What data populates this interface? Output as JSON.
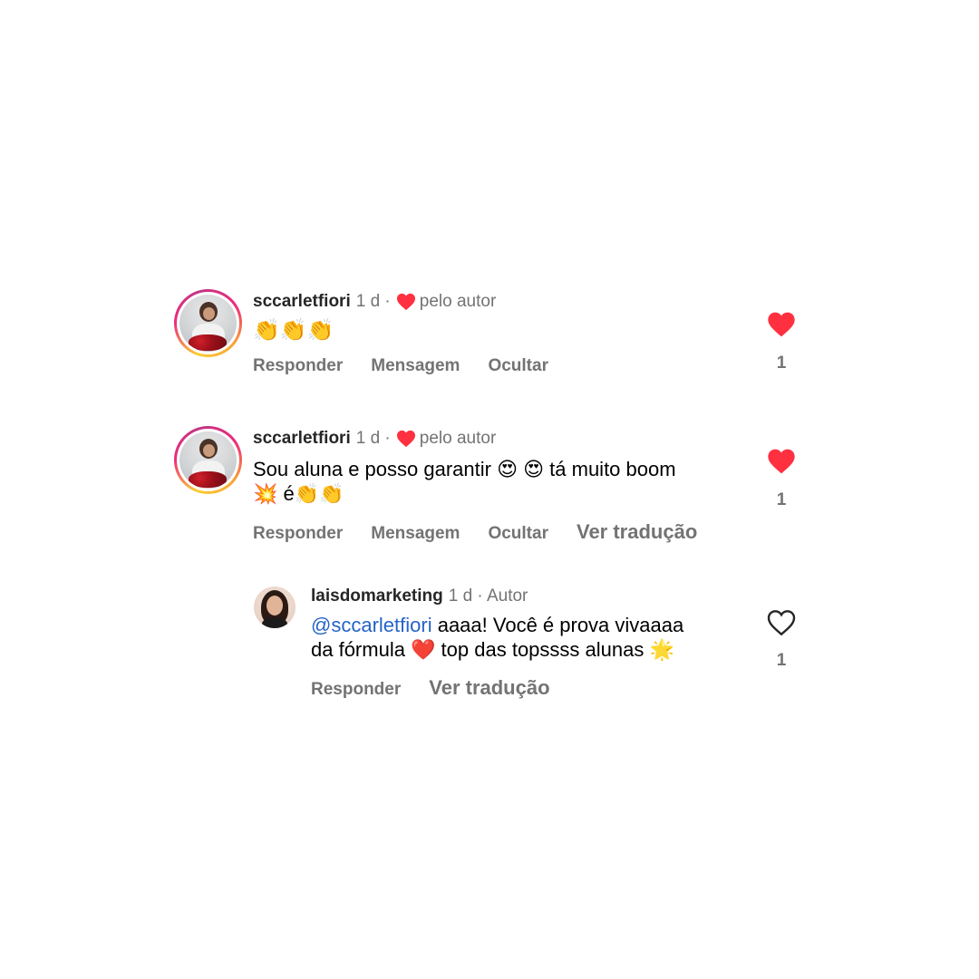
{
  "comments": [
    {
      "username": "sccarletfiori",
      "time": "1 d ·",
      "liked_by_author_label": "pelo autor",
      "text_emoji": "👏👏👏",
      "actions": {
        "reply": "Responder",
        "message": "Mensagem",
        "hide": "Ocultar"
      },
      "like_count": "1",
      "liked": true
    },
    {
      "username": "sccarletfiori",
      "time": "1 d ·",
      "liked_by_author_label": "pelo autor",
      "text_line1": "Sou aluna e posso garantir 😍 😍 tá muito boom",
      "text_line2": "💥 é👏👏",
      "actions": {
        "reply": "Responder",
        "message": "Mensagem",
        "hide": "Ocultar",
        "translate": "Ver tradução"
      },
      "like_count": "1",
      "liked": true
    }
  ],
  "reply": {
    "username": "laisdomarketing",
    "time": "1 d · Autor",
    "mention": "@sccarletfiori",
    "text_line1_rest": " aaaa! Você é prova vivaaaa",
    "text_line2": "da fórmula ❤️ top das topssss alunas 🌟",
    "actions": {
      "reply": "Responder",
      "translate": "Ver tradução"
    },
    "like_count": "1",
    "liked": false
  },
  "colors": {
    "like_red": "#ff3040",
    "mention_blue": "#2563c6",
    "muted_gray": "#737373"
  },
  "icons": {
    "liked": "heart-filled-icon",
    "unliked": "heart-outline-icon"
  }
}
